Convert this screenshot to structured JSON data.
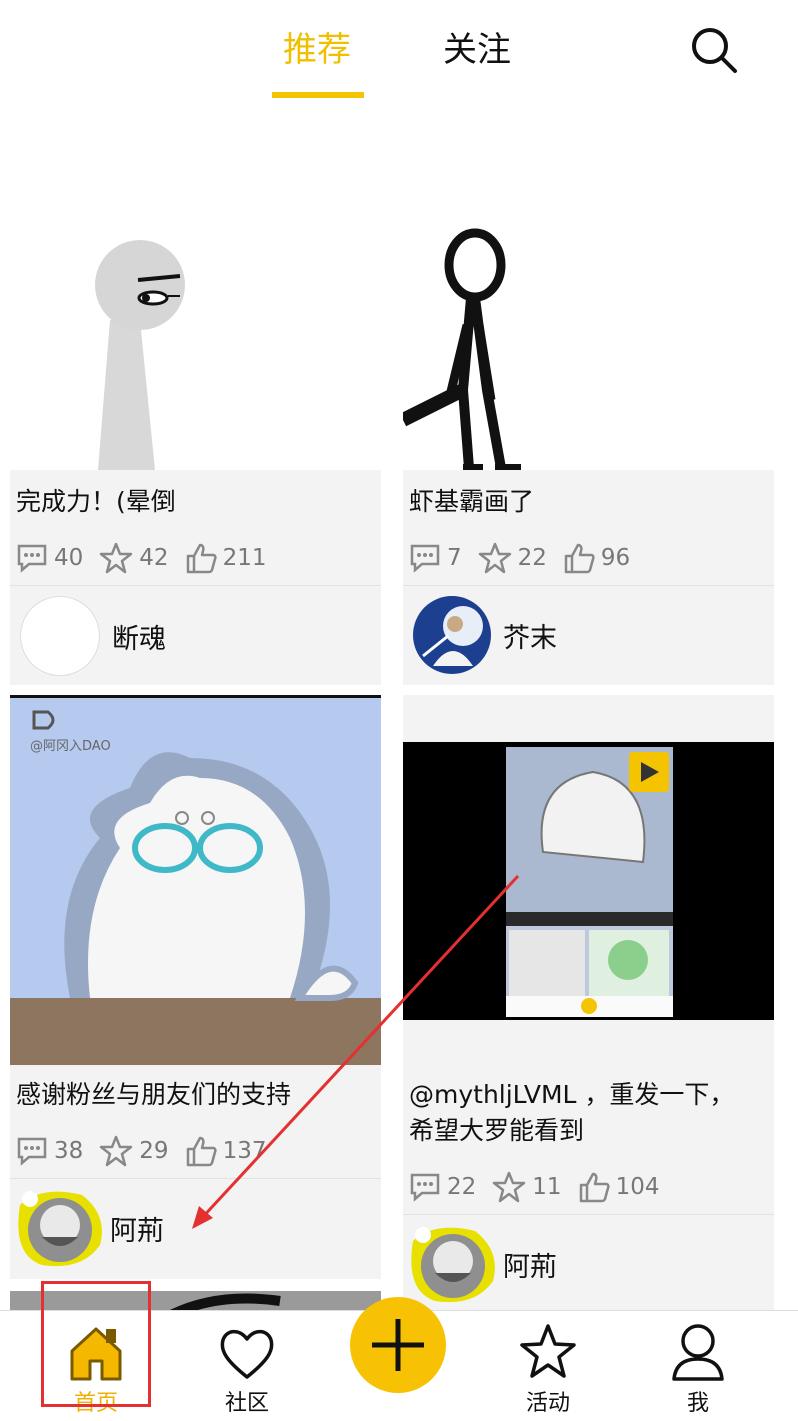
{
  "header": {
    "tabs": [
      {
        "label": "推荐",
        "active": true
      },
      {
        "label": "关注",
        "active": false
      }
    ],
    "search_icon": "search-icon",
    "accent_color": "#f5c400"
  },
  "feed": {
    "cards": [
      {
        "title": "完成力！(晕倒",
        "comments": "40",
        "stars": "42",
        "likes": "211",
        "author": "断魂"
      },
      {
        "title": "虾基霸画了",
        "comments": "7",
        "stars": "22",
        "likes": "96",
        "author": "芥末"
      },
      {
        "title": "感谢粉丝与朋友们的支持",
        "comments": "38",
        "stars": "29",
        "likes": "137",
        "author": "阿荊",
        "thumb_watermark": "@阿冈入DAO"
      },
      {
        "title_line1": "@mythljLVML ，重发一下，",
        "title_line2": "希望大罗能看到",
        "comments": "22",
        "stars": "11",
        "likes": "104",
        "author": "阿荊"
      }
    ]
  },
  "bottom_nav": {
    "items": [
      {
        "label": "首页",
        "icon": "home-icon",
        "active": true
      },
      {
        "label": "社区",
        "icon": "heart-icon",
        "active": false
      },
      {
        "label": "",
        "icon": "plus-icon",
        "active": false
      },
      {
        "label": "活动",
        "icon": "star-icon",
        "active": false
      },
      {
        "label": "我",
        "icon": "person-icon",
        "active": false
      }
    ]
  },
  "annotations": {
    "highlight_color": "#e53030"
  }
}
